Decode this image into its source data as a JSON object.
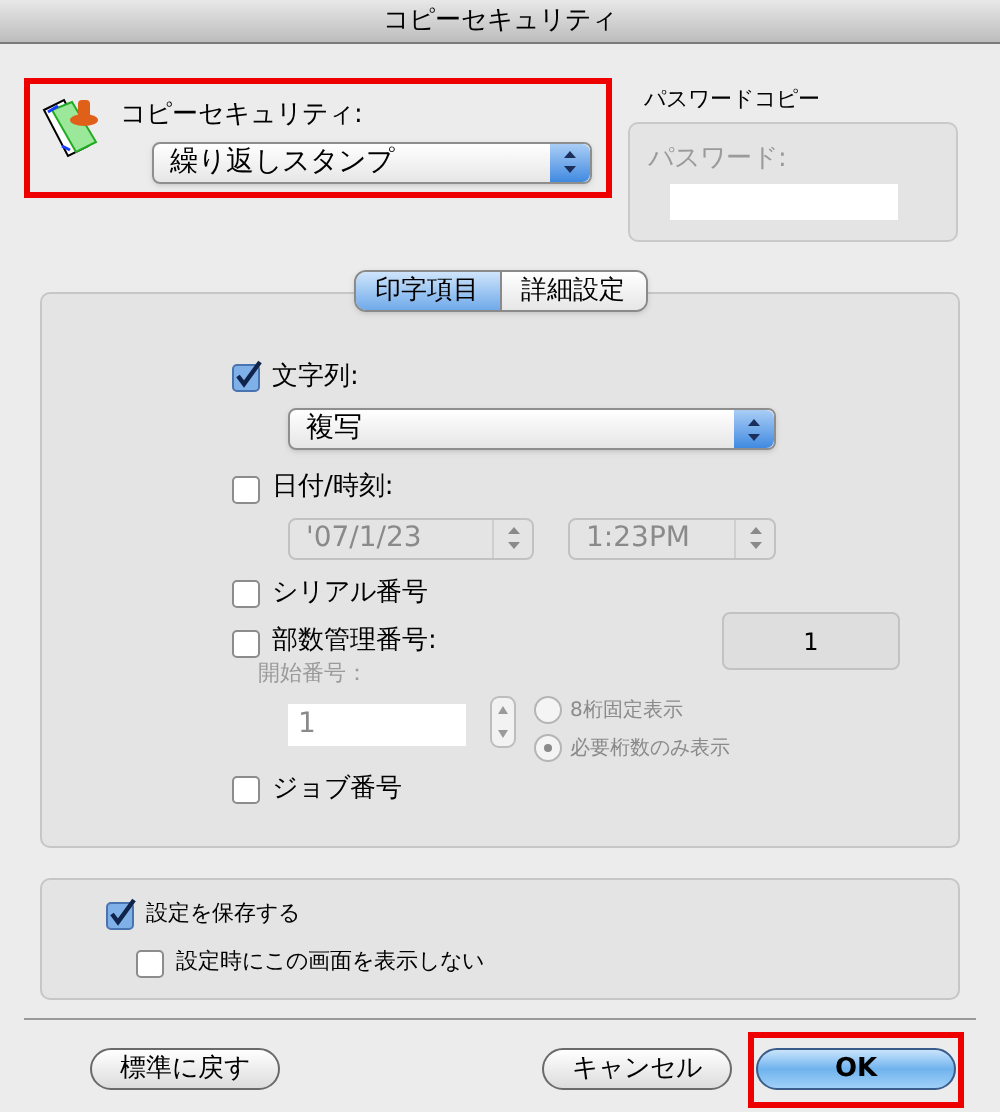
{
  "window": {
    "title": "コピーセキュリティ"
  },
  "copy_security": {
    "label": "コピーセキュリティ:",
    "value": "繰り返しスタンプ",
    "highlighted": true
  },
  "password_copy": {
    "title": "パスワードコピー",
    "label": "パスワード:",
    "disabled": true
  },
  "tabs": [
    {
      "label": "印字項目",
      "selected": true
    },
    {
      "label": "詳細設定",
      "selected": false
    }
  ],
  "text_string": {
    "label": "文字列:",
    "checked": true,
    "value": "複写"
  },
  "date_time": {
    "label": "日付/時刻:",
    "checked": false,
    "date": "'07/1/23",
    "time": "1:23PM"
  },
  "serial_number": {
    "label": "シリアル番号",
    "checked": false
  },
  "copy_number": {
    "label": "部数管理番号:",
    "checked": false,
    "value": "1",
    "start_label": "開始番号：",
    "start_value": "1",
    "options": [
      {
        "label": "8桁固定表示",
        "selected": false
      },
      {
        "label": "必要桁数のみ表示",
        "selected": true
      }
    ]
  },
  "job_number": {
    "label": "ジョブ番号",
    "checked": false
  },
  "save_settings": {
    "label": "設定を保存する",
    "checked": true
  },
  "dont_show": {
    "label": "設定時にこの画面を表示しない",
    "checked": false
  },
  "buttons": [
    {
      "label": "標準に戻す",
      "kind": "plain",
      "highlighted": false
    },
    {
      "label": "キャンセル",
      "kind": "plain",
      "highlighted": false
    },
    {
      "label": "OK",
      "kind": "primary",
      "highlighted": true
    }
  ]
}
